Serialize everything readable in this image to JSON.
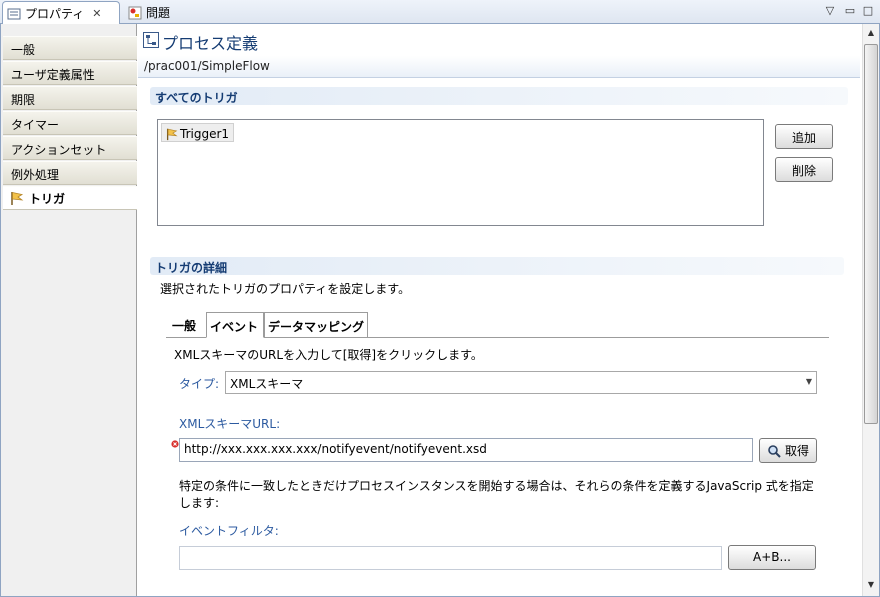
{
  "tabs": {
    "properties": "プロパティ",
    "properties_close": "✕",
    "problems": "問題"
  },
  "window_controls": {
    "menu": "▽",
    "minimize": "▭",
    "maximize": "□"
  },
  "sidebar": {
    "items": [
      {
        "label": "一般"
      },
      {
        "label": "ユーザ定義属性"
      },
      {
        "label": "期限"
      },
      {
        "label": "タイマー"
      },
      {
        "label": "アクションセット"
      },
      {
        "label": "例外処理"
      },
      {
        "label": "トリガ",
        "selected": true
      }
    ]
  },
  "header": {
    "title": "プロセス定義",
    "path": "/prac001/SimpleFlow"
  },
  "all_triggers": {
    "heading": "すべてのトリガ",
    "items": [
      "Trigger1"
    ],
    "add_label": "追加",
    "delete_label": "削除"
  },
  "trigger_detail": {
    "heading": "トリガの詳細",
    "description": "選択されたトリガのプロパティを設定します。",
    "tabs": [
      "一般",
      "イベント",
      "データマッピング"
    ],
    "active_tab": "イベント",
    "instruction": "XMLスキーマのURLを入力して[取得]をクリックします。",
    "type_label": "タイプ:",
    "type_value": "XMLスキーマ",
    "url_label": "XMLスキーマURL:",
    "url_value": "http://xxx.xxx.xxx.xxx/notifyevent/notifyevent.xsd",
    "fetch_label": "取得",
    "filter_help_1": "特定の条件に一致したときだけプロセスインスタンスを開始する場合は、それらの条件を定義するJavaScrip 式を指定",
    "filter_help_2": "します:",
    "filter_label": "イベントフィルタ:",
    "filter_value": "",
    "expr_button": "A+B..."
  },
  "colors": {
    "accent": "#153c73",
    "label_blue": "#2c5aa0",
    "error_marker": "#d9302c"
  }
}
